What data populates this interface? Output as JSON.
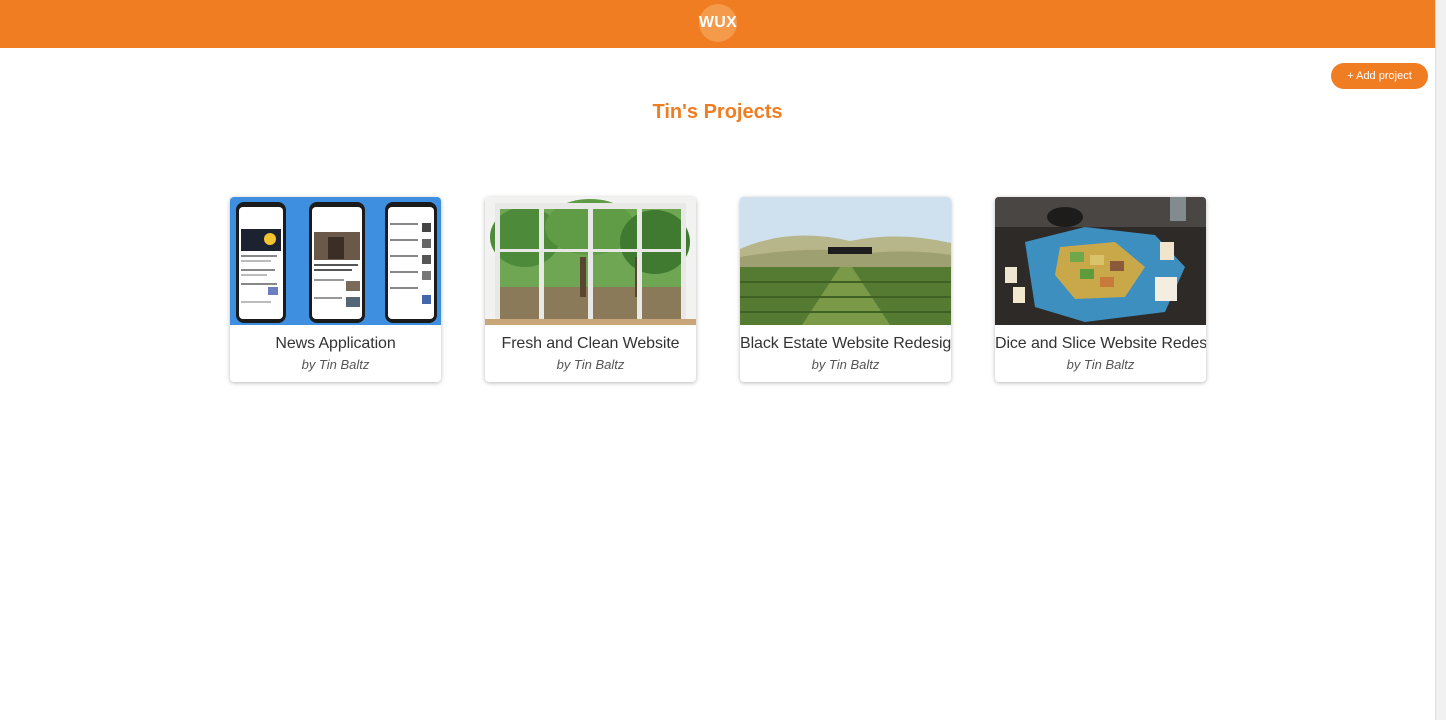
{
  "header": {
    "logo_text": "WUX"
  },
  "toolbar": {
    "add_project_label": "+ Add project"
  },
  "page": {
    "title": "Tin's Projects"
  },
  "projects": [
    {
      "title": "News Application",
      "author": "by Tin Baltz",
      "thumbnail": "phones-screens-image"
    },
    {
      "title": "Fresh and Clean Website",
      "author": "by Tin Baltz",
      "thumbnail": "window-trees-image"
    },
    {
      "title": "Black Estate Website Redesign",
      "author": "by Tin Baltz",
      "thumbnail": "vineyard-image"
    },
    {
      "title": "Dice and Slice Website Redesign",
      "author": "by Tin Baltz",
      "thumbnail": "board-game-image"
    }
  ],
  "colors": {
    "accent": "#f07d22",
    "logo_bg": "#f39a4b",
    "text": "#333333"
  }
}
